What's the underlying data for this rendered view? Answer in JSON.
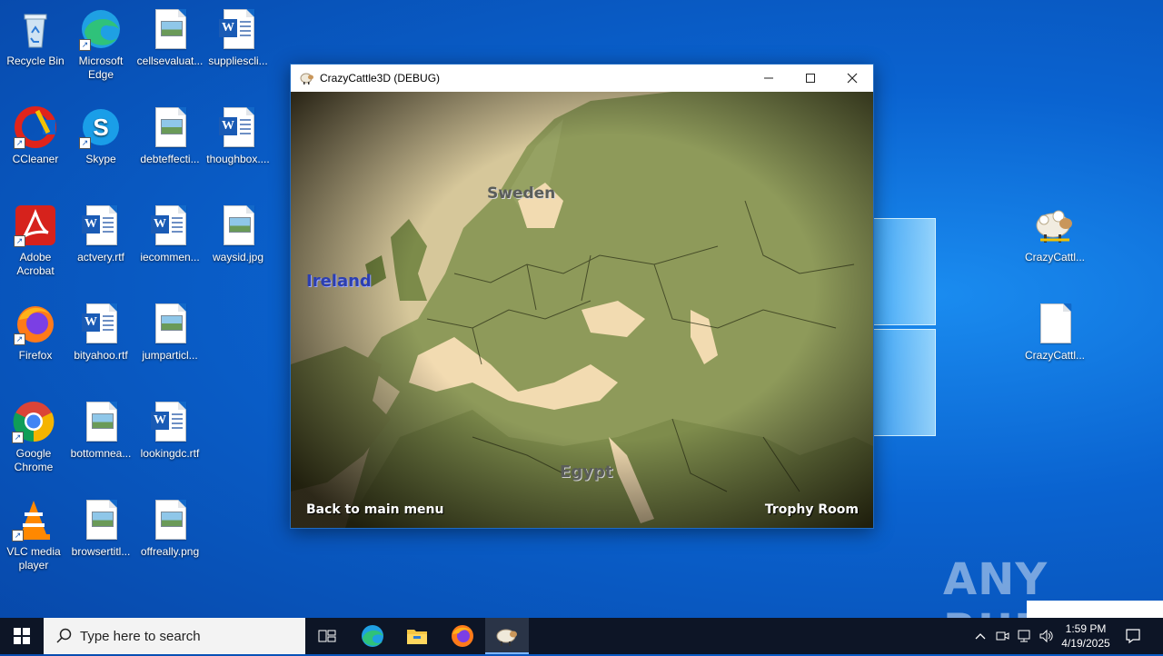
{
  "desktop": {
    "icons": [
      {
        "label": "Recycle Bin"
      },
      {
        "label": "Microsoft Edge"
      },
      {
        "label": "cellsevaluat..."
      },
      {
        "label": "suppliescli..."
      },
      {
        "label": "CCleaner"
      },
      {
        "label": "Skype"
      },
      {
        "label": "debteffecti..."
      },
      {
        "label": "thoughbox...."
      },
      {
        "label": "Adobe Acrobat"
      },
      {
        "label": "actvery.rtf"
      },
      {
        "label": "iecommen..."
      },
      {
        "label": "waysid.jpg"
      },
      {
        "label": "Firefox"
      },
      {
        "label": "bityahoo.rtf"
      },
      {
        "label": "jumparticl..."
      },
      {
        "label": "Google Chrome"
      },
      {
        "label": "bottomnea..."
      },
      {
        "label": "lookingdc.rtf"
      },
      {
        "label": "VLC media player"
      },
      {
        "label": "browsertitl..."
      },
      {
        "label": "offreally.png"
      },
      {
        "label": "CrazyCattl..."
      },
      {
        "label": "CrazyCattl..."
      }
    ],
    "watermark": "ANY RUN"
  },
  "window": {
    "title": "CrazyCattle3D (DEBUG)",
    "icon": "sheep-icon",
    "controls": {
      "minimize": "minimize-icon",
      "maximize": "maximize-icon",
      "close": "close-icon"
    }
  },
  "game": {
    "map_labels": {
      "sweden": "Sweden",
      "ireland": "Ireland",
      "egypt": "Egypt"
    },
    "menu": {
      "back": "Back to main menu",
      "trophy": "Trophy Room"
    }
  },
  "taskbar": {
    "search_placeholder": "Type here to search",
    "apps": [
      "task-view-icon",
      "edge-icon",
      "file-explorer-icon",
      "firefox-icon",
      "crazycattle-icon"
    ],
    "tray_icons": [
      "chevron-up-icon",
      "meet-now-icon",
      "network-icon",
      "volume-icon"
    ],
    "time": "1:59 PM",
    "date": "4/19/2025"
  }
}
